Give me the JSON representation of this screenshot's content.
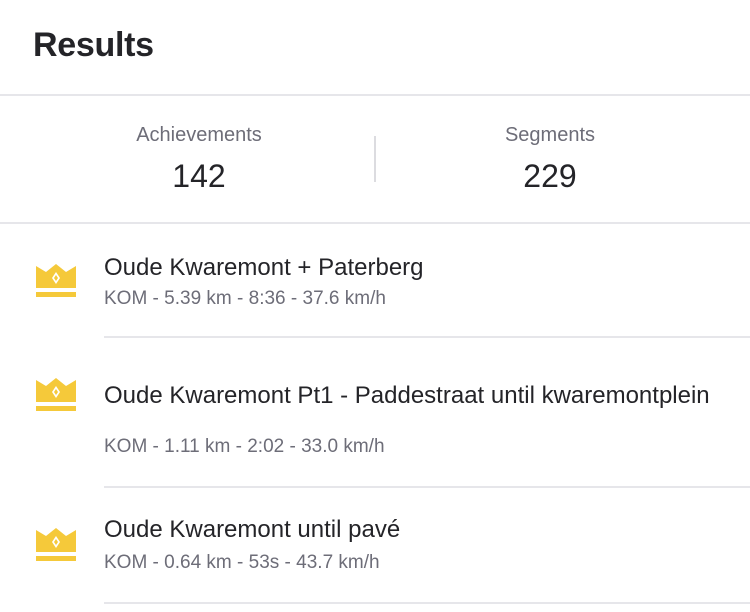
{
  "header": {
    "title": "Results"
  },
  "stats": {
    "achievements": {
      "label": "Achievements",
      "value": "142"
    },
    "segments": {
      "label": "Segments",
      "value": "229"
    }
  },
  "results": [
    {
      "icon": "crown-icon",
      "title": "Oude Kwaremont + Paterberg",
      "meta": "KOM - 5.39 km - 8:36 - 37.6 km/h"
    },
    {
      "icon": "crown-icon",
      "title": "Oude Kwaremont Pt1 - Paddestraat until kwaremontplein",
      "meta": "KOM - 1.11 km - 2:02 - 33.0 km/h"
    },
    {
      "icon": "crown-icon",
      "title": "Oude Kwaremont until pavé",
      "meta": "KOM - 0.64 km - 53s - 43.7 km/h"
    }
  ],
  "colors": {
    "crown_gold": "#f5c93a",
    "crown_dark": "#e3b227",
    "text_primary": "#242428",
    "text_secondary": "#6d6d78",
    "divider": "#e6e6ea"
  }
}
